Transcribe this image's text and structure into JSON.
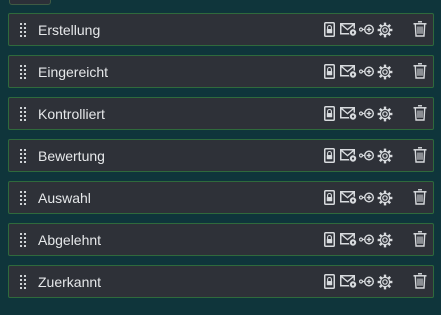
{
  "stages": [
    {
      "label": "Erstellung"
    },
    {
      "label": "Eingereicht"
    },
    {
      "label": "Kontrolliert"
    },
    {
      "label": "Bewertung"
    },
    {
      "label": "Auswahl"
    },
    {
      "label": "Abgelehnt"
    },
    {
      "label": "Zuerkannt"
    }
  ],
  "row_icons": [
    "drag-handle-icon",
    "lock-icon",
    "mail-settings-icon",
    "workflow-icon",
    "gear-icon",
    "trash-icon"
  ],
  "colors": {
    "background": "#0f353b",
    "row_background": "#2e3138",
    "row_border": "#2f6a3c",
    "text": "#e6e8ea"
  }
}
